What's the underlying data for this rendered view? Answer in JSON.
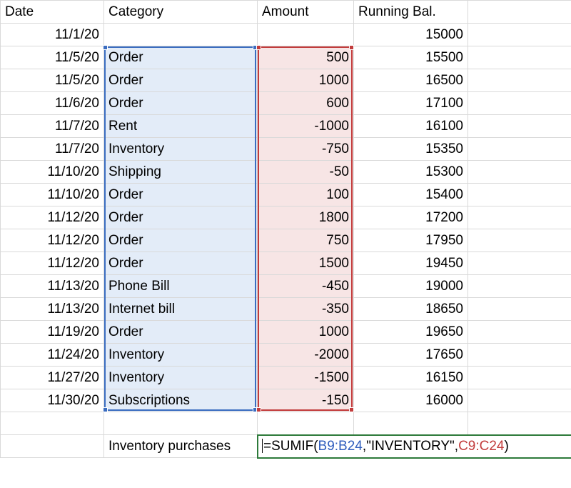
{
  "headers": {
    "date": "Date",
    "category": "Category",
    "amount": "Amount",
    "running": "Running Bal."
  },
  "rows": [
    {
      "date": "11/1/20",
      "category": "",
      "amount": "",
      "running": "15000"
    },
    {
      "date": "11/5/20",
      "category": "Order",
      "amount": "500",
      "running": "15500"
    },
    {
      "date": "11/5/20",
      "category": "Order",
      "amount": "1000",
      "running": "16500"
    },
    {
      "date": "11/6/20",
      "category": "Order",
      "amount": "600",
      "running": "17100"
    },
    {
      "date": "11/7/20",
      "category": "Rent",
      "amount": "-1000",
      "running": "16100"
    },
    {
      "date": "11/7/20",
      "category": "Inventory",
      "amount": "-750",
      "running": "15350"
    },
    {
      "date": "11/10/20",
      "category": "Shipping",
      "amount": "-50",
      "running": "15300"
    },
    {
      "date": "11/10/20",
      "category": "Order",
      "amount": "100",
      "running": "15400"
    },
    {
      "date": "11/12/20",
      "category": "Order",
      "amount": "1800",
      "running": "17200"
    },
    {
      "date": "11/12/20",
      "category": "Order",
      "amount": "750",
      "running": "17950"
    },
    {
      "date": "11/12/20",
      "category": "Order",
      "amount": "1500",
      "running": "19450"
    },
    {
      "date": "11/13/20",
      "category": "Phone Bill",
      "amount": "-450",
      "running": "19000"
    },
    {
      "date": "11/13/20",
      "category": "Internet bill",
      "amount": "-350",
      "running": "18650"
    },
    {
      "date": "11/19/20",
      "category": "Order",
      "amount": "1000",
      "running": "19650"
    },
    {
      "date": "11/24/20",
      "category": "Inventory",
      "amount": "-2000",
      "running": "17650"
    },
    {
      "date": "11/27/20",
      "category": "Inventory",
      "amount": "-1500",
      "running": "16150"
    },
    {
      "date": "11/30/20",
      "category": "Subscriptions",
      "amount": "-150",
      "running": "16000"
    }
  ],
  "summary": {
    "label": "Inventory purchases",
    "formula_prefix": "=SUMIF(",
    "formula_arg1": "B9:B24",
    "formula_mid1": ",\"INVENTORY\",",
    "formula_arg2": "C9:C24",
    "formula_suffix": ")"
  },
  "chart_data": {
    "type": "table",
    "columns": [
      "Date",
      "Category",
      "Amount",
      "Running Bal."
    ],
    "rows": [
      [
        "11/1/20",
        "",
        null,
        15000
      ],
      [
        "11/5/20",
        "Order",
        500,
        15500
      ],
      [
        "11/5/20",
        "Order",
        1000,
        16500
      ],
      [
        "11/6/20",
        "Order",
        600,
        17100
      ],
      [
        "11/7/20",
        "Rent",
        -1000,
        16100
      ],
      [
        "11/7/20",
        "Inventory",
        -750,
        15350
      ],
      [
        "11/10/20",
        "Shipping",
        -50,
        15300
      ],
      [
        "11/10/20",
        "Order",
        100,
        15400
      ],
      [
        "11/12/20",
        "Order",
        1800,
        17200
      ],
      [
        "11/12/20",
        "Order",
        750,
        17950
      ],
      [
        "11/12/20",
        "Order",
        1500,
        19450
      ],
      [
        "11/13/20",
        "Phone Bill",
        -450,
        19000
      ],
      [
        "11/13/20",
        "Internet bill",
        -350,
        18650
      ],
      [
        "11/19/20",
        "Order",
        1000,
        19650
      ],
      [
        "11/24/20",
        "Inventory",
        -2000,
        17650
      ],
      [
        "11/27/20",
        "Inventory",
        -1500,
        16150
      ],
      [
        "11/30/20",
        "Subscriptions",
        -150,
        16000
      ]
    ],
    "formula": "=SUMIF(B9:B24,\"INVENTORY\",C9:C24)"
  }
}
